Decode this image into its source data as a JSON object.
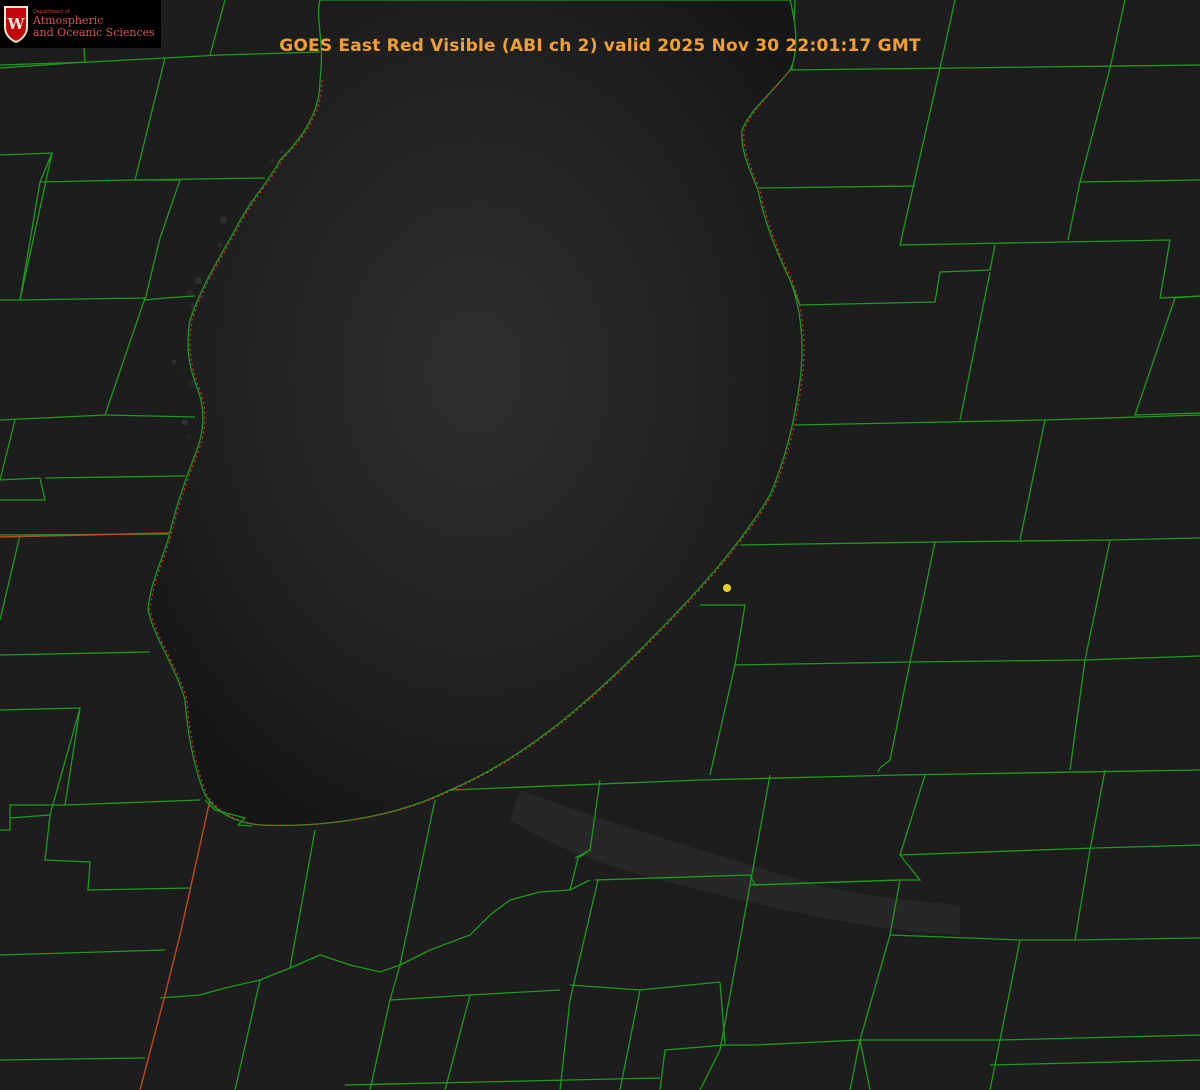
{
  "title": "GOES East Red Visible (ABI ch 2) valid 2025 Nov 30 22:01:17 GMT",
  "logo": {
    "dept": "Department of",
    "line1": "Atmospheric",
    "line2": "and Oceanic Sciences",
    "crest_letter": "W"
  },
  "colors": {
    "title": "#f0a030",
    "county_lines": "#1e9a1e",
    "state_line": "#c04a1a",
    "shoreline": "#e03030",
    "marker": "#e8d020",
    "land": "#1c1c1c",
    "lake": "#141414"
  },
  "icons": [
    "uw-crest-icon",
    "location-marker-icon"
  ]
}
